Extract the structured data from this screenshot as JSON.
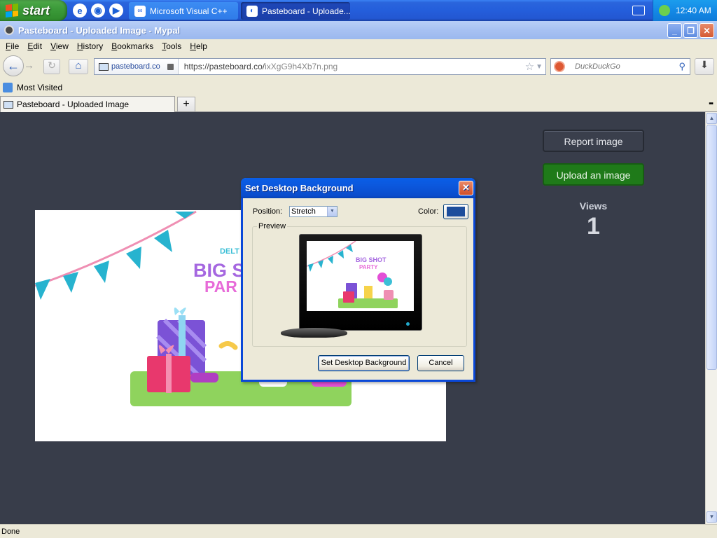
{
  "taskbar": {
    "start_label": "start",
    "tasks": [
      {
        "label": "Microsoft Visual C++"
      },
      {
        "label": "Pasteboard - Uploade..."
      }
    ],
    "clock": "12:40 AM"
  },
  "window": {
    "title": "Pasteboard - Uploaded Image - Mypal"
  },
  "menu": [
    "File",
    "Edit",
    "View",
    "History",
    "Bookmarks",
    "Tools",
    "Help"
  ],
  "navbar": {
    "site_identity": "pasteboard.co",
    "url_host": "https://pasteboard.co/",
    "url_path": "ixXgG9h4Xb7n.png",
    "search_placeholder": "DuckDuckGo"
  },
  "bookmarks": {
    "most_visited": "Most Visited"
  },
  "tabs": {
    "active_label": "Pasteboard - Uploaded Image",
    "new_tab": "+"
  },
  "page": {
    "report_button": "Report image",
    "upload_button": "Upload an image",
    "views_label": "Views",
    "views_count": "1",
    "image_text": {
      "line1": "DELT",
      "line2": "BIG S",
      "line3": "PAR"
    }
  },
  "dialog": {
    "title": "Set Desktop Background",
    "position_label": "Position:",
    "position_value": "Stretch",
    "color_label": "Color:",
    "preview_label": "Preview",
    "preview_text": {
      "line1": "BIG SHOT",
      "line2": "PARTY"
    },
    "set_button": "Set Desktop Background",
    "cancel_button": "Cancel"
  },
  "status": {
    "text": "Done"
  },
  "colors": {
    "page_bg": "#383d4a",
    "upload_green": "#1f7a19",
    "dialog_border": "#0a48d8",
    "swatch": "#1d4e9c"
  }
}
